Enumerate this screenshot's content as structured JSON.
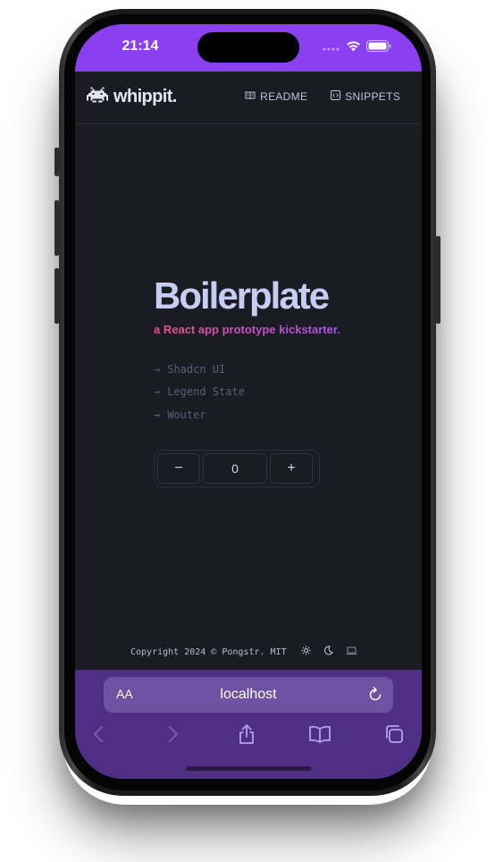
{
  "status_bar": {
    "time": "21:14"
  },
  "app": {
    "logo_text": "whippit.",
    "nav": [
      {
        "label": "README",
        "icon": "book-icon"
      },
      {
        "label": "SNIPPETS",
        "icon": "code-square-icon"
      }
    ]
  },
  "hero": {
    "title": "Boilerplate",
    "subtitle": "a React app prototype kickstarter.",
    "features": [
      "Shadcn UI",
      "Legend State",
      "Wouter"
    ]
  },
  "counter": {
    "decrement": "−",
    "value": "0",
    "increment": "+"
  },
  "footer": {
    "copyright": "Copyright 2024 © Pongstr. MIT"
  },
  "browser": {
    "text_size_label": "AA",
    "url": "localhost"
  },
  "colors": {
    "status_bar": "#8a3ff0",
    "background": "#1b1b23",
    "browser_bar": "#4f2f86",
    "gradient_start": "#e9508f",
    "gradient_end": "#a656f0"
  }
}
